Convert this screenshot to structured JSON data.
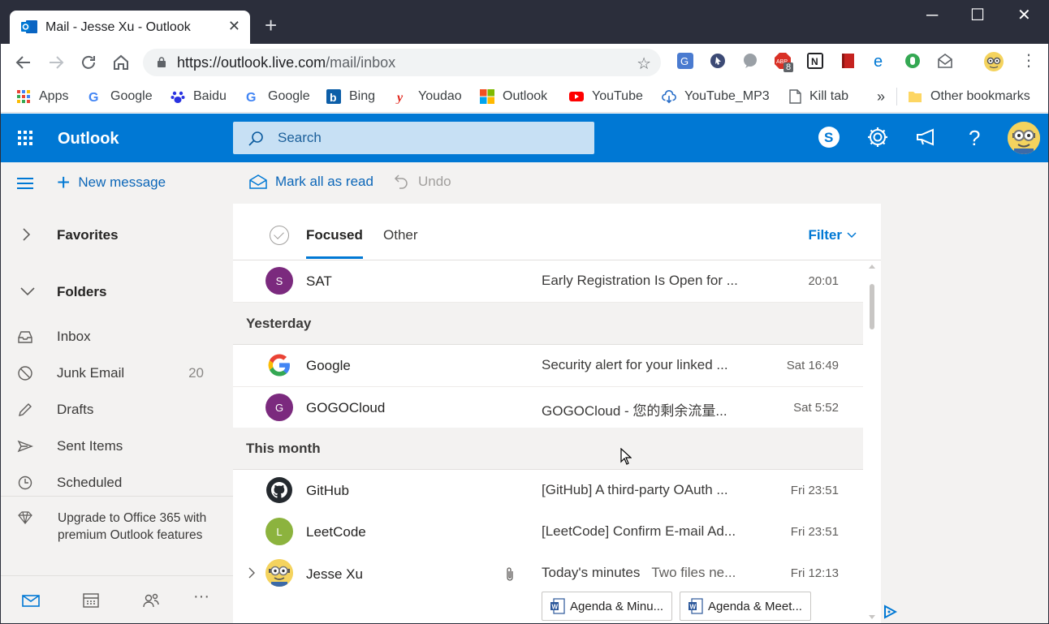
{
  "browser": {
    "tab": {
      "title": "Mail - Jesse Xu - Outlook",
      "close_glyph": "✕"
    },
    "new_tab_glyph": "+",
    "window_buttons": {
      "minimize": "─",
      "maximize": "☐",
      "close": "✕"
    },
    "address": {
      "url_host": "https://outlook.live.com",
      "url_path": "/mail/inbox"
    },
    "extension_badge": "8",
    "bookmarks": [
      {
        "label": "Apps",
        "icon": "apps-grid-icon"
      },
      {
        "label": "Google",
        "icon": "google-icon"
      },
      {
        "label": "Baidu",
        "icon": "baidu-paw-icon"
      },
      {
        "label": "Google",
        "icon": "google-icon"
      },
      {
        "label": "Bing",
        "icon": "bing-icon"
      },
      {
        "label": "Youdao",
        "icon": "youdao-icon"
      },
      {
        "label": "Outlook",
        "icon": "microsoft-icon"
      },
      {
        "label": "YouTube",
        "icon": "youtube-icon"
      },
      {
        "label": "YouTube_MP3",
        "icon": "cloud-download-icon"
      },
      {
        "label": "Kill tab",
        "icon": "page-icon"
      }
    ],
    "bookmarks_overflow": "»",
    "other_bookmarks": "Other bookmarks"
  },
  "app": {
    "name": "Outlook",
    "search_placeholder": "Search",
    "accent": "#0078d4"
  },
  "commands": {
    "new_message": "New message",
    "mark_all_read": "Mark all as read",
    "undo": "Undo"
  },
  "nav": {
    "favorites": "Favorites",
    "folders": "Folders",
    "folder_items": [
      {
        "label": "Inbox",
        "icon": "inbox-icon",
        "count": ""
      },
      {
        "label": "Junk Email",
        "icon": "blocked-icon",
        "count": "20"
      },
      {
        "label": "Drafts",
        "icon": "pencil-icon",
        "count": ""
      },
      {
        "label": "Sent Items",
        "icon": "send-icon",
        "count": ""
      },
      {
        "label": "Scheduled",
        "icon": "clock-icon",
        "count": ""
      }
    ],
    "upgrade": "Upgrade to Office 365 with premium Outlook features"
  },
  "list": {
    "tabs": {
      "focused": "Focused",
      "other": "Other"
    },
    "filter": "Filter",
    "groups": {
      "yesterday": "Yesterday",
      "this_month": "This month"
    },
    "messages": [
      {
        "sender": "SAT",
        "initial": "S",
        "avatar_color": "#7b2a7e",
        "subject": "Early Registration Is Open for ...",
        "preview": "",
        "time": "20:01"
      },
      {
        "sender": "Google",
        "initial": "",
        "avatar_color": "#ffffff",
        "subject": "Security alert for your linked ...",
        "preview": "",
        "time": "Sat 16:49"
      },
      {
        "sender": "GOGOCloud",
        "initial": "G",
        "avatar_color": "#7b2a7e",
        "subject": "GOGOCloud - 您的剩余流量...",
        "preview": "",
        "time": "Sat 5:52"
      },
      {
        "sender": "GitHub",
        "initial": "",
        "avatar_color": "#24292e",
        "subject": "[GitHub] A third-party OAuth ...",
        "preview": "",
        "time": "Fri 23:51"
      },
      {
        "sender": "LeetCode",
        "initial": "L",
        "avatar_color": "#8cb33e",
        "subject": "[LeetCode] Confirm E-mail Ad...",
        "preview": "",
        "time": "Fri 23:51"
      },
      {
        "sender": "Jesse Xu",
        "initial": "",
        "avatar_color": "#f4d35e",
        "subject": "Today's minutes",
        "preview": "Two files ne...",
        "time": "Fri 12:13"
      }
    ],
    "attachments": [
      "Agenda & Minu...",
      "Agenda & Meet..."
    ]
  }
}
